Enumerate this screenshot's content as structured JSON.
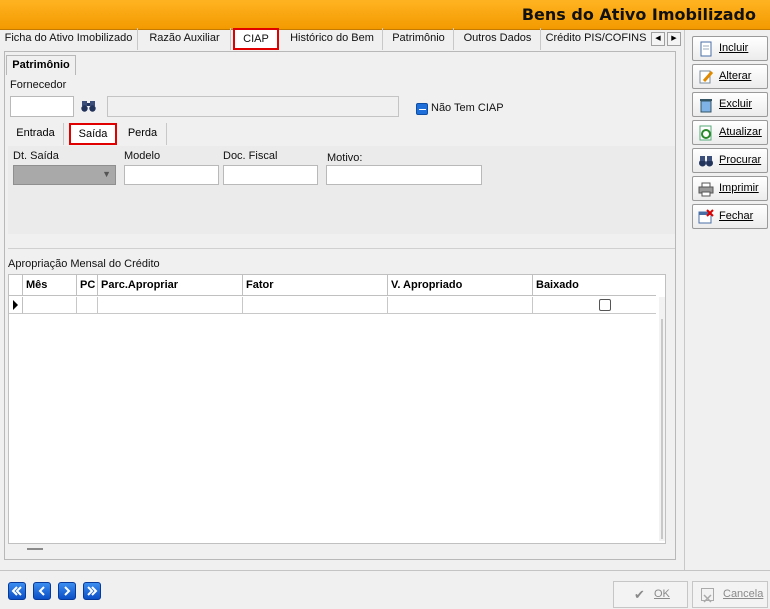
{
  "window": {
    "title": "Bens do Ativo Imobilizado"
  },
  "main_tabs": [
    {
      "label": "Ficha do Ativo Imobilizado"
    },
    {
      "label": "Razão Auxiliar"
    },
    {
      "label": "CIAP"
    },
    {
      "label": "Histórico do Bem"
    },
    {
      "label": "Patrimônio"
    },
    {
      "label": "Outros Dados"
    },
    {
      "label": "Crédito PIS/COFINS"
    }
  ],
  "active_main_tab": "CIAP",
  "section_tab": "Patrimônio",
  "fornecedor": {
    "label": "Fornecedor",
    "code_value": "",
    "name_value": ""
  },
  "nao_tem_ciap": {
    "label": "Não Tem CIAP"
  },
  "sub_tabs": [
    {
      "label": "Entrada"
    },
    {
      "label": "Saída"
    },
    {
      "label": "Perda"
    }
  ],
  "active_sub_tab": "Saída",
  "saida_fields": {
    "dt_saida_label": "Dt. Saída",
    "modelo_label": "Modelo",
    "doc_fiscal_label": "Doc. Fiscal",
    "motivo_label": "Motivo:"
  },
  "grid": {
    "title": "Apropriação Mensal do Crédito",
    "columns": [
      "Mês",
      "PC",
      "Parc.Apropriar",
      "Fator",
      "V. Apropriado",
      "Baixado"
    ]
  },
  "side_buttons": [
    {
      "label": "Incluir"
    },
    {
      "label": "Alterar"
    },
    {
      "label": "Excluir"
    },
    {
      "label": "Atualizar"
    },
    {
      "label": "Procurar"
    },
    {
      "label": "Imprimir"
    },
    {
      "label": "Fechar"
    }
  ],
  "bottom": {
    "ok_label": "OK",
    "cancel_label": "Cancela"
  },
  "colors": {
    "title_bar": "#f5a000",
    "highlight": "#e00000",
    "nav_blue": "#1a62d8"
  }
}
